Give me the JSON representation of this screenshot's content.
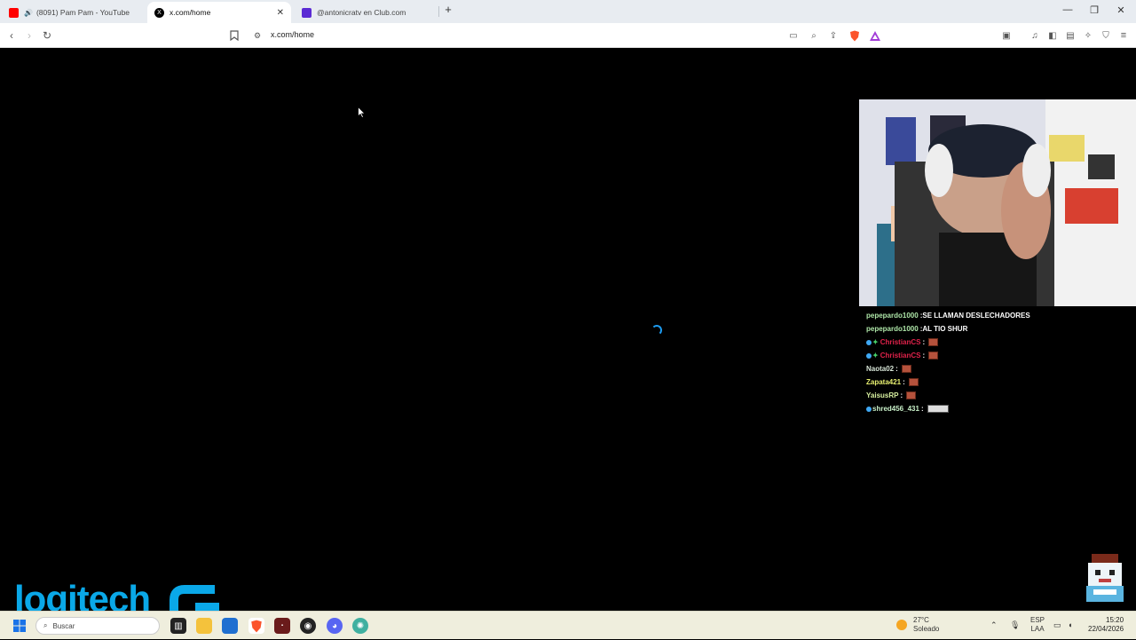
{
  "tabs": [
    {
      "title": "(8091) Pam Pam - YouTube",
      "favicon": "youtube-icon"
    },
    {
      "title": "x.com/home",
      "favicon": "x-icon"
    },
    {
      "title": "@antonicratv en Club.com",
      "favicon": "club-icon"
    }
  ],
  "toolbar": {
    "url": "x.com/home"
  },
  "chat": [
    {
      "user": "pepepardo1000",
      "sep": " : ",
      "message": "SE LLAMAN DESLECHADORES",
      "user_color": "#aee6a8",
      "badges": []
    },
    {
      "user": "pepepardo1000",
      "sep": " : ",
      "message": "AL TIO SHUR",
      "user_color": "#aee6a8",
      "badges": []
    },
    {
      "user": "ChristianCS",
      "sep": " : ",
      "message": "",
      "user_color": "#e0224a",
      "badges": [
        "dot",
        "star"
      ],
      "emote": "square"
    },
    {
      "user": "ChristianCS",
      "sep": " : ",
      "message": "",
      "user_color": "#e0224a",
      "badges": [
        "dot",
        "star"
      ],
      "emote": "square"
    },
    {
      "user": "Naota02",
      "sep": " : ",
      "message": "",
      "user_color": "#d8e6d8",
      "badges": [],
      "emote": "square"
    },
    {
      "user": "Zapata421",
      "sep": " : ",
      "message": "",
      "user_color": "#e8f070",
      "badges": [],
      "emote": "square"
    },
    {
      "user": "YaisusRP",
      "sep": " : ",
      "message": "",
      "user_color": "#d8f0a0",
      "badges": [],
      "emote": "square"
    },
    {
      "user": "shred456_431",
      "sep": " : ",
      "message": "",
      "user_color": "#c8f0c8",
      "badges": [
        "dot"
      ],
      "emote": "wide"
    }
  ],
  "overlay": {
    "logo_text": "logitech"
  },
  "taskbar": {
    "search_placeholder": "Buscar",
    "weather_temp": "27°C",
    "weather_desc": "Soleado",
    "lang_top": "ESP",
    "lang_bottom": "LAA",
    "time": "15:20",
    "date": "22/04/2026"
  }
}
